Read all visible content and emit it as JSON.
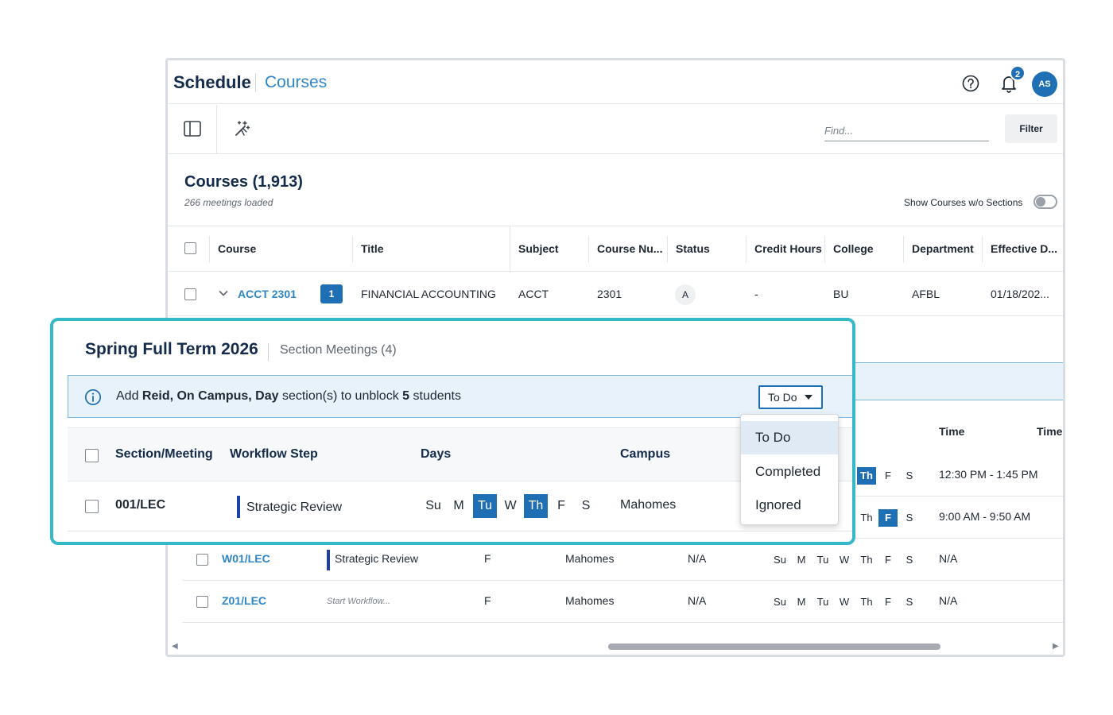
{
  "header": {
    "brand": "Schedule",
    "section": "Courses",
    "notification_count": "2",
    "avatar_initials": "AS"
  },
  "toolbar": {
    "find_placeholder": "Find...",
    "filter_label": "Filter"
  },
  "courses": {
    "title": "Courses (1,913)",
    "subtitle": "266 meetings loaded",
    "toggle_label": "Show Courses w/o Sections",
    "columns": [
      "Course",
      "Title",
      "Subject",
      "Course Nu...",
      "Status",
      "Credit Hours",
      "College",
      "Department",
      "Effective D..."
    ],
    "row": {
      "course": "ACCT 2301",
      "count": "1",
      "title": "FINANCIAL ACCOUNTING",
      "subject": "ACCT",
      "number": "2301",
      "status": "A",
      "credit_hours": "-",
      "college": "BU",
      "department": "AFBL",
      "effective": "01/18/202..."
    }
  },
  "background_sections": {
    "time_headers": [
      "Time",
      "Time"
    ],
    "day_labels": [
      "Su",
      "M",
      "Tu",
      "W",
      "Th",
      "F",
      "S"
    ],
    "rows": [
      {
        "partial_days": [
          "Th",
          "F",
          "S"
        ],
        "time": "12:30 PM - 1:45 PM"
      },
      {
        "partial_days": [
          "Th",
          "F",
          "S"
        ],
        "time": "9:00 AM - 9:50 AM"
      },
      {
        "section": "W01/LEC",
        "workflow": "Strategic Review",
        "day": "F",
        "campus": "Mahomes",
        "na": "N/A",
        "time": "N/A"
      },
      {
        "section": "Z01/LEC",
        "workflow": "Start Workflow...",
        "day": "F",
        "campus": "Mahomes",
        "na": "N/A",
        "time": "N/A"
      }
    ]
  },
  "card": {
    "term": "Spring Full Term 2026",
    "meetings": "Section Meetings (4)",
    "banner": {
      "pre": "Add ",
      "bold1": "Reid, On Campus, Day",
      "mid": " section(s) to unblock ",
      "bold2": "5",
      "post": " students"
    },
    "status_button": "To Do",
    "columns": [
      "Section/Meeting",
      "Workflow Step",
      "Days",
      "Campus"
    ],
    "row": {
      "section": "001/LEC",
      "workflow": "Strategic Review",
      "days": [
        "Su",
        "M",
        "Tu",
        "W",
        "Th",
        "F",
        "S"
      ],
      "campus": "Mahomes"
    }
  },
  "status_menu": {
    "items": [
      "To Do",
      "Completed",
      "Ignored"
    ],
    "selected": "To Do"
  },
  "colors": {
    "brand_navy": "#142b4c",
    "link_blue": "#2f86c7",
    "accent_blue": "#1f6fb5",
    "card_border": "#35b9c9",
    "workflow_bar": "#1c3fa8"
  }
}
